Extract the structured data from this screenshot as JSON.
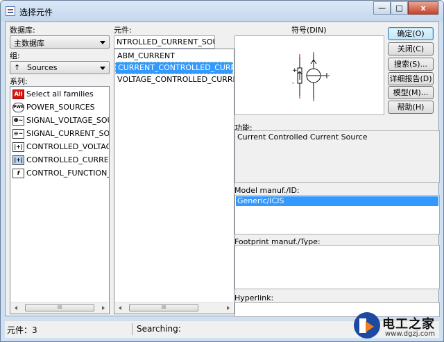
{
  "window": {
    "title": "选择元件",
    "minimize": "—",
    "maximize": "□",
    "close": "x"
  },
  "database": {
    "label": "数据库:",
    "value": "主数据库"
  },
  "group": {
    "label": "组:",
    "value": "Sources"
  },
  "family": {
    "label": "系列:",
    "items": [
      {
        "icon": "All",
        "label": "Select all families"
      },
      {
        "icon": "PWR",
        "label": "POWER_SOURCES"
      },
      {
        "icon": "Φ~",
        "label": "SIGNAL_VOLTAGE_SOURC"
      },
      {
        "icon": "⊖~",
        "label": "SIGNAL_CURRENT_SOURC"
      },
      {
        "icon": "|+|",
        "label": "CONTROLLED_VOLTAGE_S"
      },
      {
        "icon": "|+|",
        "label": "CONTROLLED_CURRENT_S"
      },
      {
        "icon": "f",
        "label": "CONTROL_FUNCTION_BLO"
      }
    ],
    "scroll_thumb": "III"
  },
  "component": {
    "label": "元件:",
    "value": "NTROLLED_CURRENT_SOURCE",
    "items": [
      {
        "label": "ABM_CURRENT"
      },
      {
        "label": "CURRENT_CONTROLLED_CURRENT_"
      },
      {
        "label": "VOLTAGE_CONTROLLED_CURRENT_S"
      }
    ],
    "scroll_thumb": "III"
  },
  "symbol": {
    "label": "符号(DIN)",
    "plus": "+",
    "minus": "-"
  },
  "function": {
    "label": "功能:",
    "value": "Current Controlled Current Source"
  },
  "model": {
    "label": "Model manuf./ID:",
    "value": "Generic/ICIS"
  },
  "footprint": {
    "label": "Footprint manuf./Type:"
  },
  "hyperlink": {
    "label": "Hyperlink:"
  },
  "buttons": {
    "ok": "确定(O)",
    "close": "关闭(C)",
    "search": "搜索(S)...",
    "detail": "详细报告(D)",
    "model": "模型(M)...",
    "help": "帮助(H)"
  },
  "status": {
    "count": "元件：3",
    "searching": "Searching:"
  },
  "watermark": {
    "name": "电工之家",
    "url": "www.dgzj.com"
  }
}
